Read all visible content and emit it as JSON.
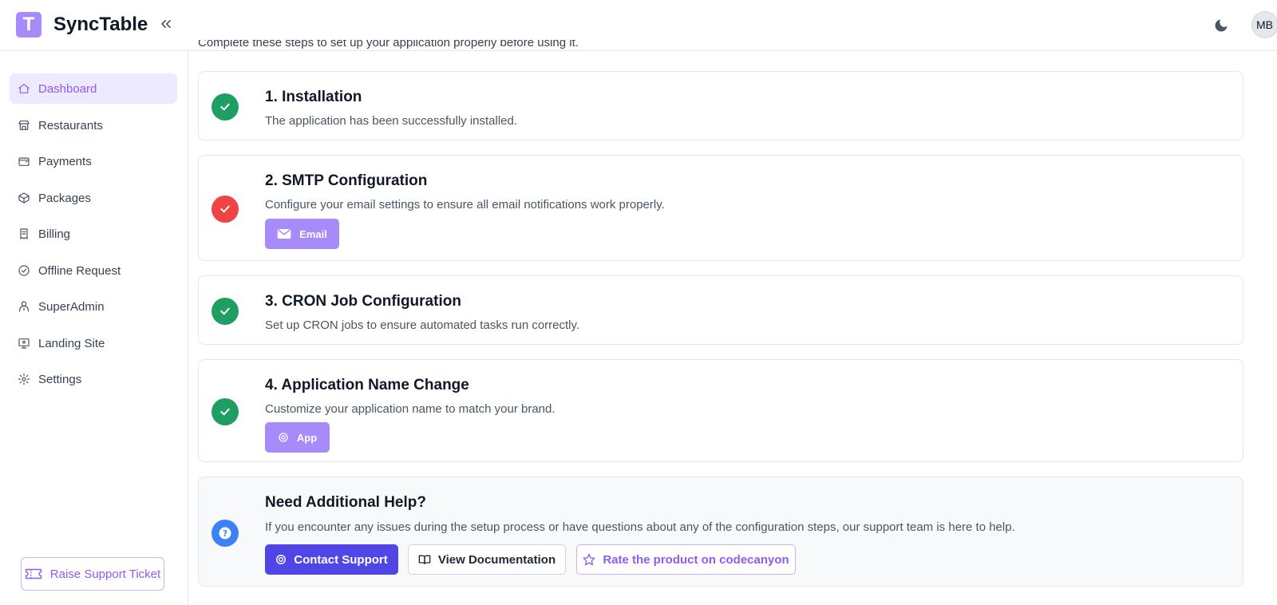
{
  "app": {
    "logo_letter": "T",
    "name": "SyncTable"
  },
  "header": {
    "avatar_initials": "MB"
  },
  "sidebar": {
    "items": [
      {
        "label": "Dashboard",
        "icon": "home-icon",
        "active": true
      },
      {
        "label": "Restaurants",
        "icon": "store-icon",
        "active": false
      },
      {
        "label": "Payments",
        "icon": "wallet-icon",
        "active": false
      },
      {
        "label": "Packages",
        "icon": "box-icon",
        "active": false
      },
      {
        "label": "Billing",
        "icon": "receipt-icon",
        "active": false
      },
      {
        "label": "Offline Request",
        "icon": "check-circle-icon",
        "active": false
      },
      {
        "label": "SuperAdmin",
        "icon": "user-admin-icon",
        "active": false
      },
      {
        "label": "Landing Site",
        "icon": "monitor-icon",
        "active": false
      },
      {
        "label": "Settings",
        "icon": "gear-icon",
        "active": false
      }
    ],
    "support_ticket_label": "Raise Support Ticket"
  },
  "main": {
    "intro": "Complete these steps to set up your application properly before using it.",
    "steps": [
      {
        "title": "1. Installation",
        "description": "The application has been successfully installed.",
        "status": "complete"
      },
      {
        "title": "2. SMTP Configuration",
        "description": "Configure your email settings to ensure all email notifications work properly.",
        "status": "incomplete",
        "button_label": "Email"
      },
      {
        "title": "3. CRON Job Configuration",
        "description": "Set up CRON jobs to ensure automated tasks run correctly.",
        "status": "complete"
      },
      {
        "title": "4. Application Name Change",
        "description": "Customize your application name to match your brand.",
        "status": "complete",
        "button_label": "App"
      }
    ],
    "help": {
      "title": "Need Additional Help?",
      "description": "If you encounter any issues during the setup process or have questions about any of the configuration steps, our support team is here to help.",
      "contact_label": "Contact Support",
      "docs_label": "View Documentation",
      "rate_label": "Rate the product on codecanyon"
    }
  },
  "colors": {
    "accent": "#a78bfa",
    "primary": "#4f46e5",
    "success": "#1e9e63",
    "danger": "#ef4444",
    "info": "#3b82f6"
  }
}
